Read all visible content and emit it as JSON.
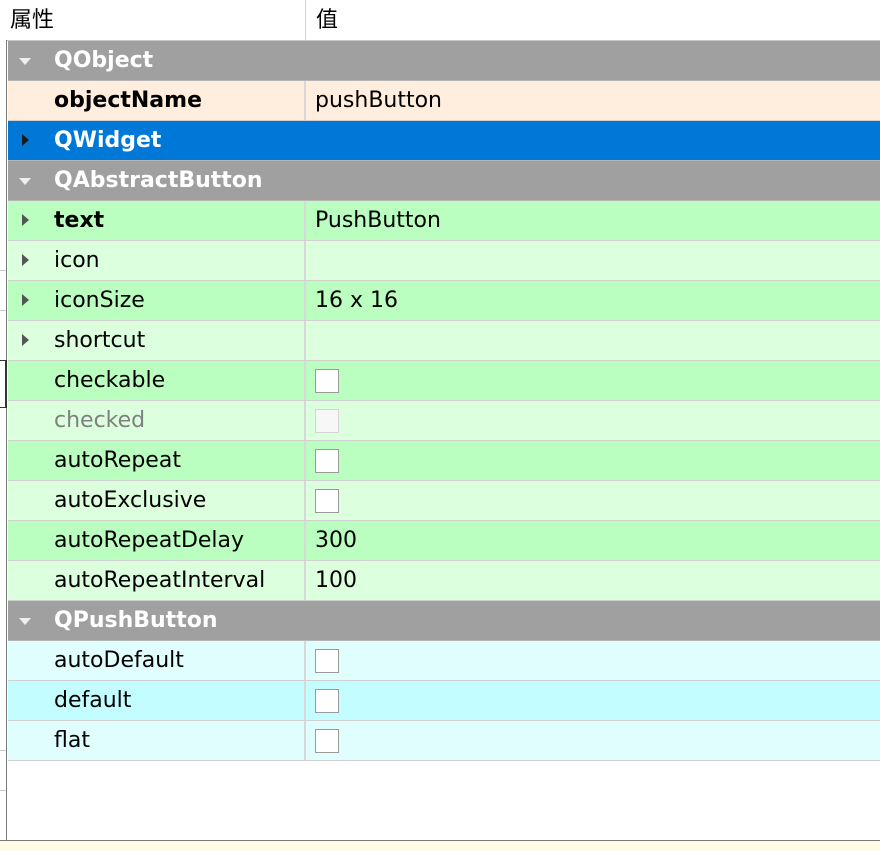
{
  "header": {
    "col_property": "属性",
    "col_value": "值"
  },
  "groups": {
    "qobject": "QObject",
    "qwidget": "QWidget",
    "qabstractbutton": "QAbstractButton",
    "qpushbutton": "QPushButton"
  },
  "rows": {
    "objectName": {
      "label": "objectName",
      "value": "pushButton"
    },
    "text": {
      "label": "text",
      "value": "PushButton"
    },
    "icon": {
      "label": "icon",
      "value": ""
    },
    "iconSize": {
      "label": "iconSize",
      "value": "16 x 16"
    },
    "shortcut": {
      "label": "shortcut",
      "value": ""
    },
    "checkable": {
      "label": "checkable",
      "checked": false
    },
    "checked": {
      "label": "checked",
      "checked": false,
      "enabled": false
    },
    "autoRepeat": {
      "label": "autoRepeat",
      "checked": false
    },
    "autoExclusive": {
      "label": "autoExclusive",
      "checked": false
    },
    "autoRepeatDelay": {
      "label": "autoRepeatDelay",
      "value": "300"
    },
    "autoRepeatInterval": {
      "label": "autoRepeatInterval",
      "value": "100"
    },
    "autoDefault": {
      "label": "autoDefault",
      "checked": false
    },
    "default": {
      "label": "default",
      "checked": false
    },
    "flat": {
      "label": "flat",
      "checked": false
    }
  },
  "colors": {
    "group_header": "#a0a0a0",
    "selection": "#0078d7",
    "qobject_row": "#ffeedd",
    "abstractbutton_row_a": "#baffc0",
    "abstractbutton_row_b": "#dcffde",
    "pushbutton_row_a": "#e1feff",
    "pushbutton_row_b": "#c4fdff"
  },
  "icons": {
    "expanded": "triangle-down",
    "collapsed": "triangle-right"
  }
}
